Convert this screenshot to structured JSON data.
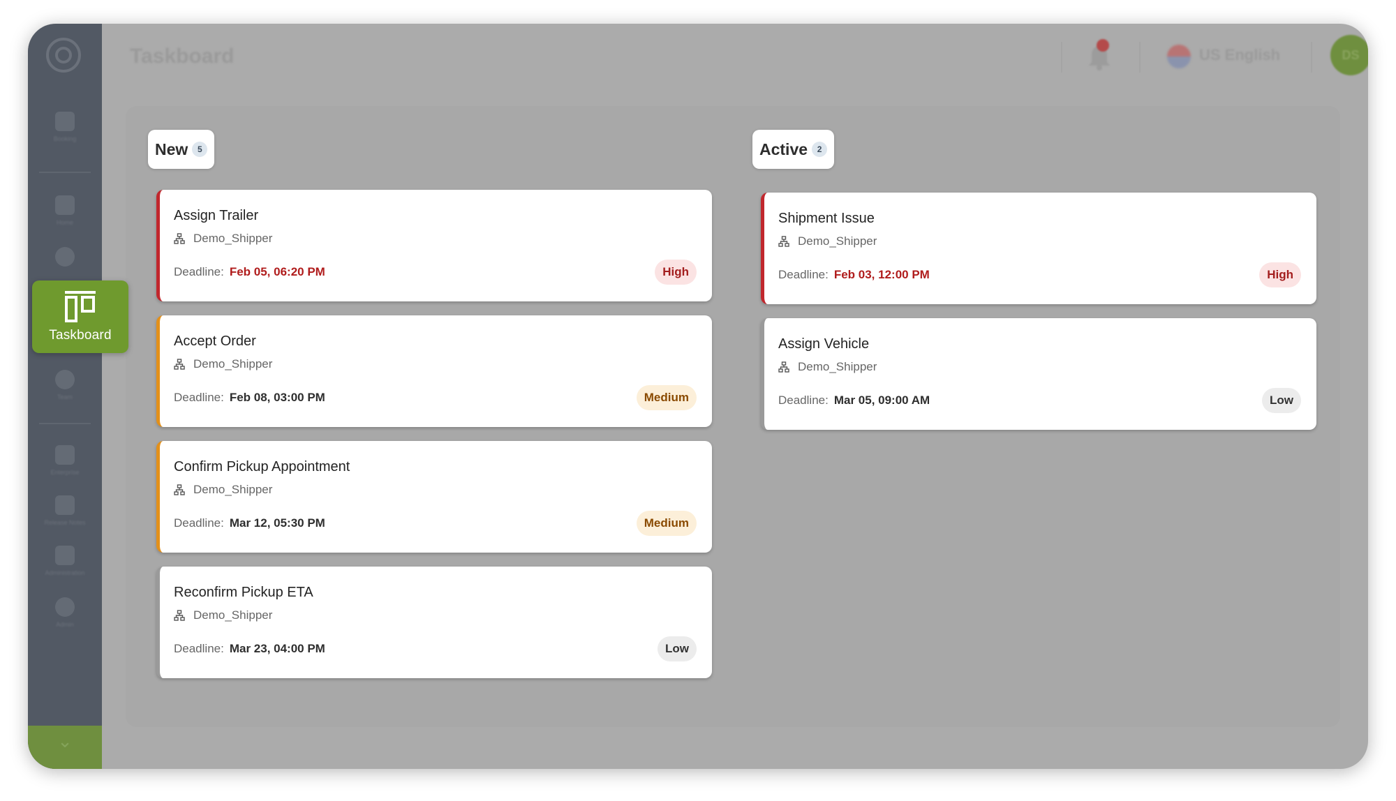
{
  "sidebar": {
    "items": [
      {
        "label": "Booking",
        "icon": "booking-icon"
      },
      {
        "label": "Home",
        "icon": "home-icon"
      },
      {
        "label": "Globe",
        "icon": "globe-icon"
      },
      {
        "label": "Taskboard",
        "icon": "taskboard-icon"
      },
      {
        "label": "Team",
        "icon": "team-icon"
      },
      {
        "label": "Enterprise",
        "icon": "enterprise-icon"
      },
      {
        "label": "Release Notes",
        "icon": "release-notes-icon"
      },
      {
        "label": "Administration",
        "icon": "administration-icon"
      },
      {
        "label": "Admin",
        "icon": "admin-icon"
      }
    ],
    "active_label": "Taskboard",
    "expand_icon": "chevron-down-icon"
  },
  "header": {
    "title": "Taskboard",
    "notification_count": "1",
    "language": "US English",
    "avatar_initials": "DS"
  },
  "columns": [
    {
      "title": "New",
      "count": "5",
      "cards": [
        {
          "title": "Assign Trailer",
          "org": "Demo_Shipper",
          "deadline_label": "Deadline:",
          "deadline": "Feb 05, 06:20 PM",
          "priority": "High"
        },
        {
          "title": "Accept Order",
          "org": "Demo_Shipper",
          "deadline_label": "Deadline:",
          "deadline": "Feb 08, 03:00 PM",
          "priority": "Medium"
        },
        {
          "title": "Confirm Pickup Appointment",
          "org": "Demo_Shipper",
          "deadline_label": "Deadline:",
          "deadline": "Mar 12, 05:30 PM",
          "priority": "Medium"
        },
        {
          "title": "Reconfirm Pickup ETA",
          "org": "Demo_Shipper",
          "deadline_label": "Deadline:",
          "deadline": "Mar 23, 04:00 PM",
          "priority": "Low"
        }
      ]
    },
    {
      "title": "Active",
      "count": "2",
      "cards": [
        {
          "title": "Shipment Issue",
          "org": "Demo_Shipper",
          "deadline_label": "Deadline:",
          "deadline": "Feb 03, 12:00 PM",
          "priority": "High"
        },
        {
          "title": "Assign Vehicle",
          "org": "Demo_Shipper",
          "deadline_label": "Deadline:",
          "deadline": "Mar 05, 09:00 AM",
          "priority": "Low"
        }
      ]
    }
  ],
  "colors": {
    "accent": "#6f9a2e",
    "high": "#c1272d",
    "medium": "#e3901a",
    "low": "#9a9a9a"
  }
}
